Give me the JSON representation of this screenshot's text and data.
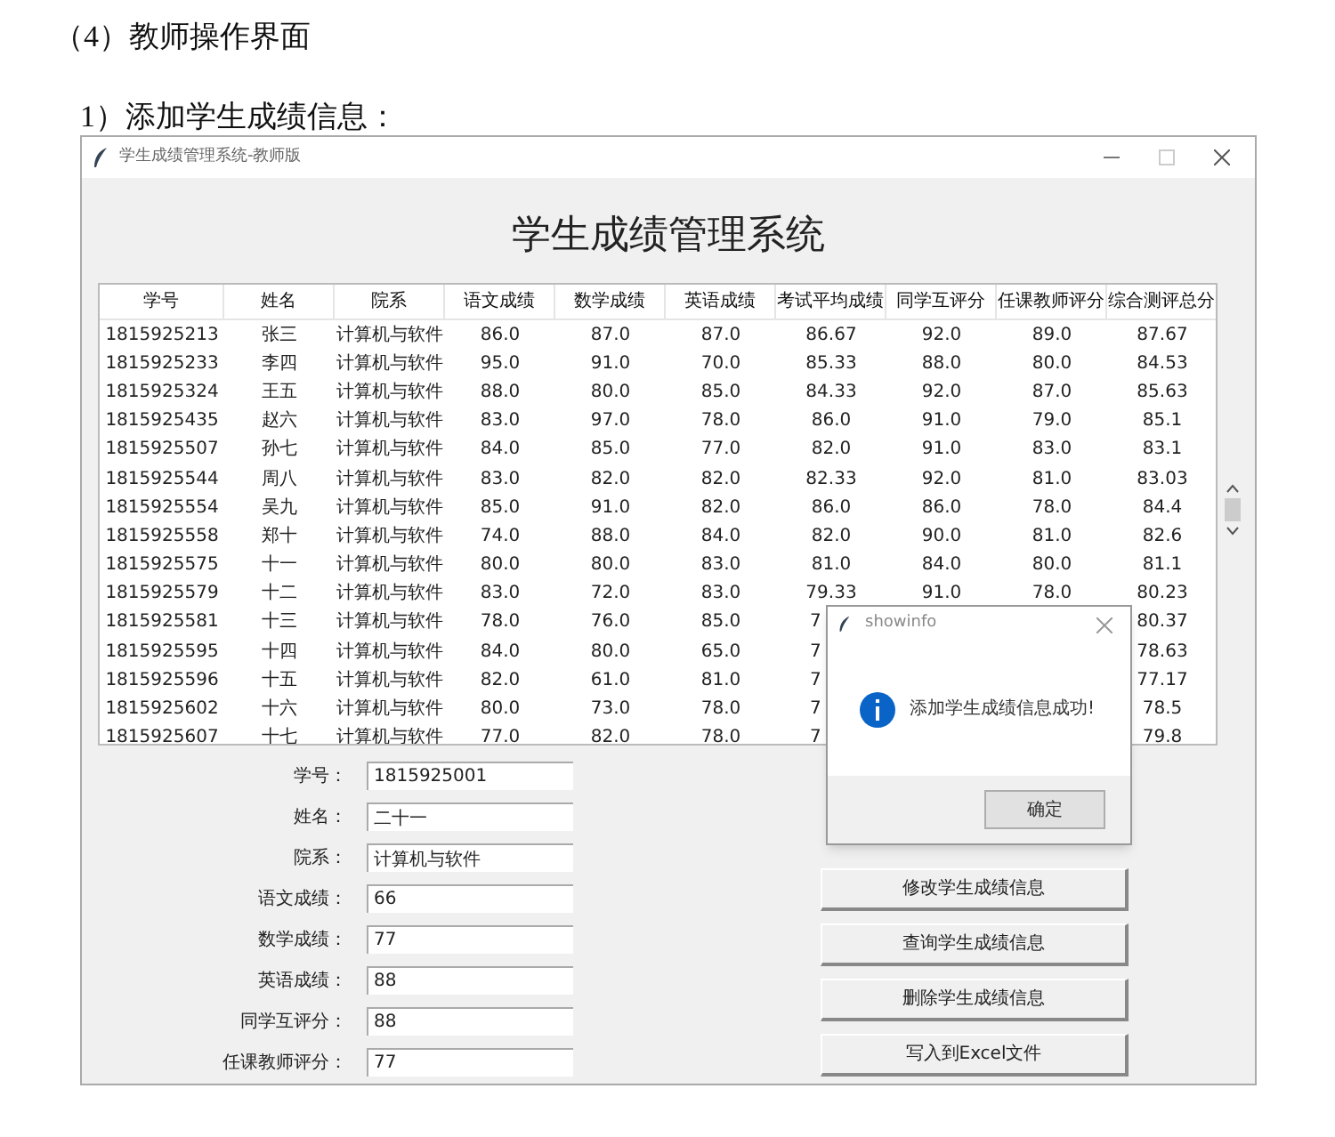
{
  "doc_heading": "（4）教师操作界面",
  "doc_subheading": "1）添加学生成绩信息：",
  "window": {
    "title": "学生成绩管理系统-教师版",
    "heading": "学生成绩管理系统",
    "table": {
      "columns": [
        "学号",
        "姓名",
        "院系",
        "语文成绩",
        "数学成绩",
        "英语成绩",
        "考试平均成绩",
        "同学互评分",
        "任课教师评分",
        "综合测评总分"
      ],
      "rows": [
        [
          "1815925213",
          "张三",
          "计算机与软件",
          "86.0",
          "87.0",
          "87.0",
          "86.67",
          "92.0",
          "89.0",
          "87.67"
        ],
        [
          "1815925233",
          "李四",
          "计算机与软件",
          "95.0",
          "91.0",
          "70.0",
          "85.33",
          "88.0",
          "80.0",
          "84.53"
        ],
        [
          "1815925324",
          "王五",
          "计算机与软件",
          "88.0",
          "80.0",
          "85.0",
          "84.33",
          "92.0",
          "87.0",
          "85.63"
        ],
        [
          "1815925435",
          "赵六",
          "计算机与软件",
          "83.0",
          "97.0",
          "78.0",
          "86.0",
          "91.0",
          "79.0",
          "85.1"
        ],
        [
          "1815925507",
          "孙七",
          "计算机与软件",
          "84.0",
          "85.0",
          "77.0",
          "82.0",
          "91.0",
          "83.0",
          "83.1"
        ],
        [
          "1815925544",
          "周八",
          "计算机与软件",
          "83.0",
          "82.0",
          "82.0",
          "82.33",
          "92.0",
          "81.0",
          "83.03"
        ],
        [
          "1815925554",
          "吴九",
          "计算机与软件",
          "85.0",
          "91.0",
          "82.0",
          "86.0",
          "86.0",
          "78.0",
          "84.4"
        ],
        [
          "1815925558",
          "郑十",
          "计算机与软件",
          "74.0",
          "88.0",
          "84.0",
          "82.0",
          "90.0",
          "81.0",
          "82.6"
        ],
        [
          "1815925575",
          "十一",
          "计算机与软件",
          "80.0",
          "80.0",
          "83.0",
          "81.0",
          "84.0",
          "80.0",
          "81.1"
        ],
        [
          "1815925579",
          "十二",
          "计算机与软件",
          "83.0",
          "72.0",
          "83.0",
          "79.33",
          "91.0",
          "78.0",
          "80.23"
        ],
        [
          "1815925581",
          "十三",
          "计算机与软件",
          "78.0",
          "76.0",
          "85.0",
          "7",
          null,
          null,
          "80.37"
        ],
        [
          "1815925595",
          "十四",
          "计算机与软件",
          "84.0",
          "80.0",
          "65.0",
          "7",
          null,
          null,
          "78.63"
        ],
        [
          "1815925596",
          "十五",
          "计算机与软件",
          "82.0",
          "61.0",
          "81.0",
          "7",
          null,
          null,
          "77.17"
        ],
        [
          "1815925602",
          "十六",
          "计算机与软件",
          "80.0",
          "73.0",
          "78.0",
          "7",
          null,
          null,
          "78.5"
        ],
        [
          "1815925607",
          "十七",
          "计算机与软件",
          "77.0",
          "82.0",
          "78.0",
          "7",
          null,
          null,
          "79.8"
        ]
      ]
    },
    "form": [
      {
        "label": "学号：",
        "value": "1815925001"
      },
      {
        "label": "姓名：",
        "value": "二十一"
      },
      {
        "label": "院系：",
        "value": "计算机与软件"
      },
      {
        "label": "语文成绩：",
        "value": "66"
      },
      {
        "label": "数学成绩：",
        "value": "77"
      },
      {
        "label": "英语成绩：",
        "value": "88"
      },
      {
        "label": "同学互评分：",
        "value": "88"
      },
      {
        "label": "任课教师评分：",
        "value": "77"
      }
    ],
    "buttons": [
      "修改学生成绩信息",
      "查询学生成绩信息",
      "删除学生成绩信息",
      "写入到Excel文件"
    ]
  },
  "dialog": {
    "title": "showinfo",
    "message": "添加学生成绩信息成功!",
    "button": "确定"
  }
}
